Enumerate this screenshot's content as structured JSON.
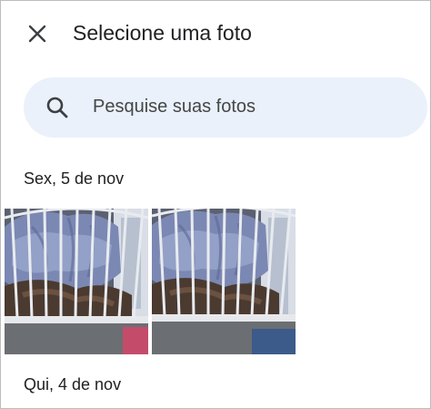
{
  "header": {
    "title": "Selecione uma foto",
    "close_icon": "close-icon"
  },
  "search": {
    "placeholder": "Pesquise suas fotos",
    "icon": "search-icon"
  },
  "groups": [
    {
      "date": "Sex, 5 de nov",
      "photos": [
        {
          "description_name": "photo-crib-1"
        },
        {
          "description_name": "photo-crib-2"
        }
      ]
    },
    {
      "date": "Qui, 4 de nov",
      "photos": []
    }
  ],
  "colors": {
    "search_bg": "#eaf1fb",
    "text_primary": "#202124",
    "text_secondary": "#444746"
  }
}
